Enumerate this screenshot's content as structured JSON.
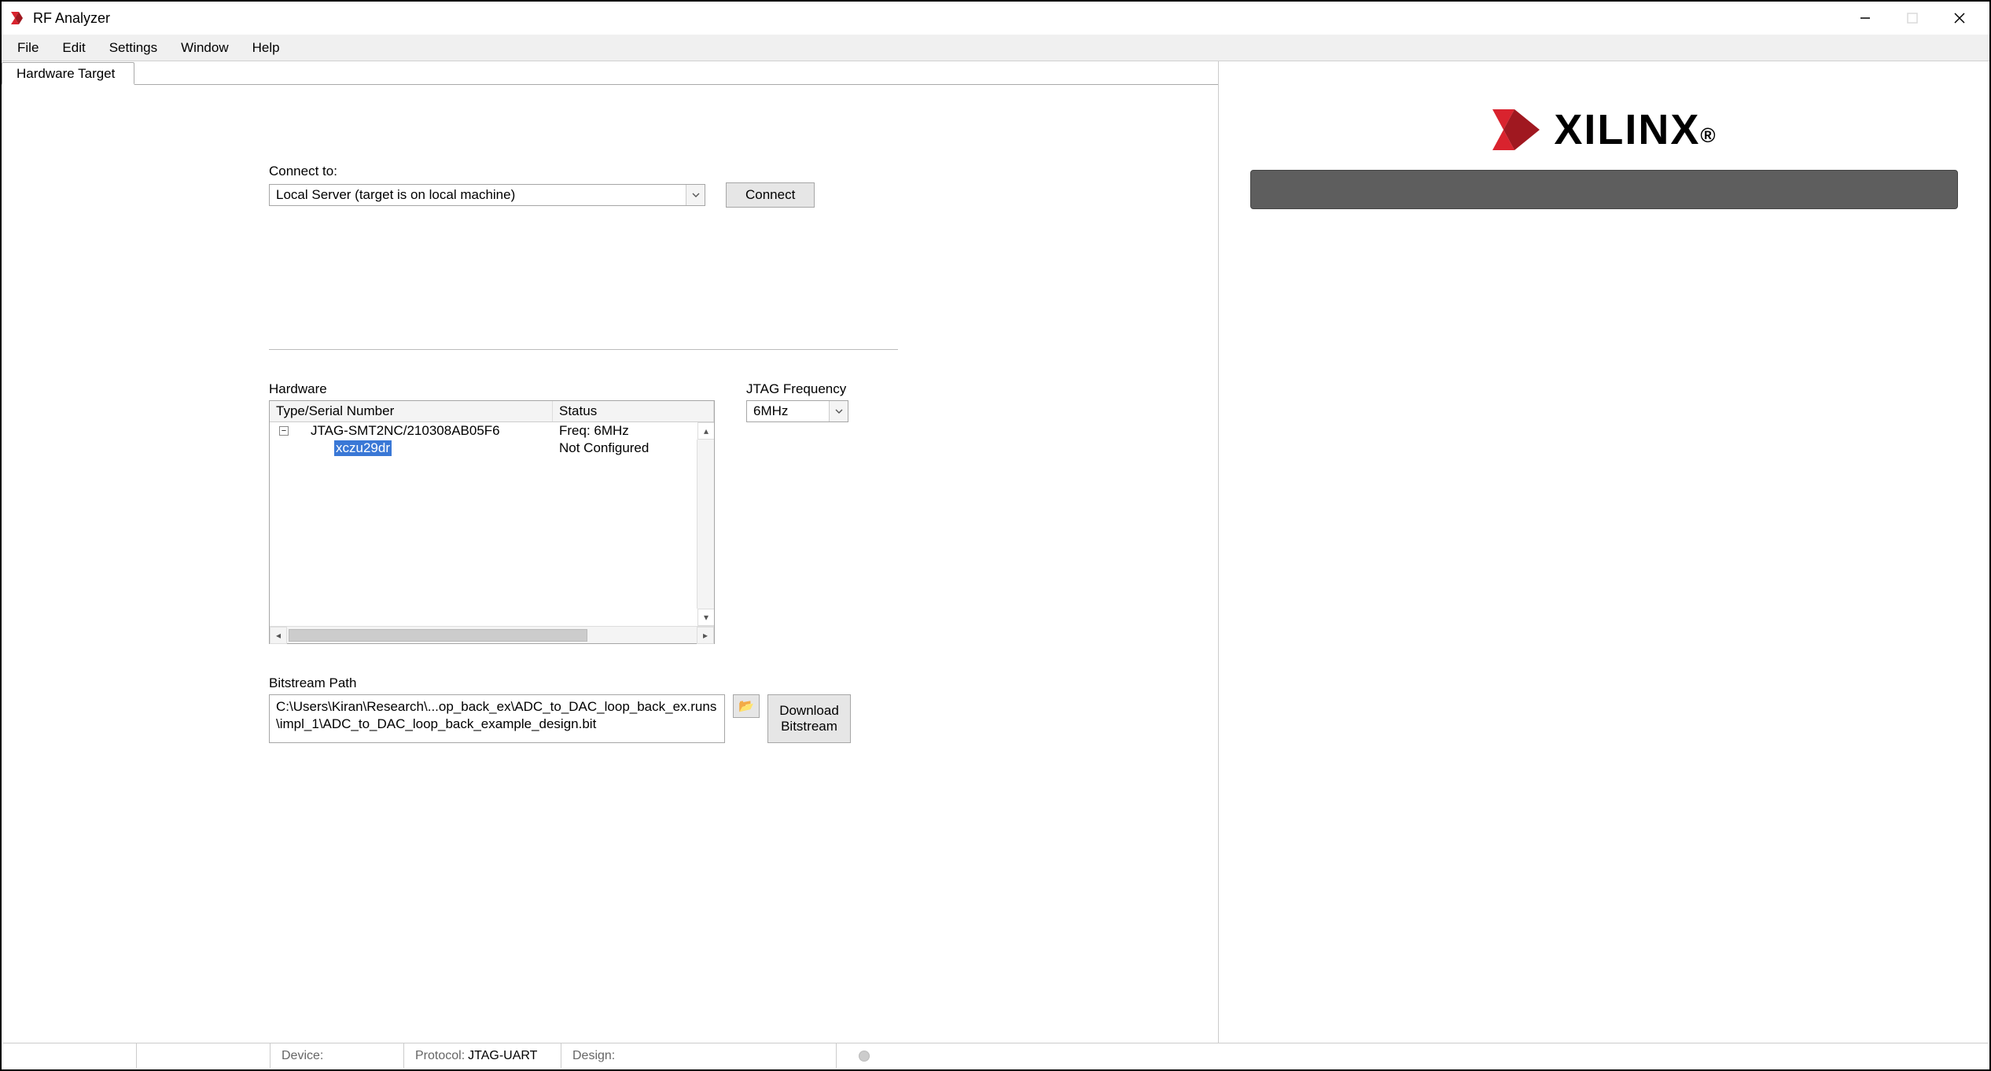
{
  "window": {
    "title": "RF Analyzer"
  },
  "menu": {
    "file": "File",
    "edit": "Edit",
    "settings": "Settings",
    "window": "Window",
    "help": "Help"
  },
  "tabs": {
    "hardware_target": "Hardware Target"
  },
  "connect": {
    "label": "Connect to:",
    "value": "Local Server (target is on local machine)",
    "button": "Connect"
  },
  "hardware": {
    "label": "Hardware",
    "col_type": "Type/Serial Number",
    "col_status": "Status",
    "row0_type": "JTAG-SMT2NC/210308AB05F6",
    "row0_status": "Freq: 6MHz",
    "row1_type": "xczu29dr",
    "row1_status": "Not Configured"
  },
  "jtag": {
    "label": "JTAG Frequency",
    "value": "6MHz"
  },
  "bitstream": {
    "label": "Bitstream Path",
    "path": "C:\\Users\\Kiran\\Research\\...op_back_ex\\ADC_to_DAC_loop_back_ex.runs\\impl_1\\ADC_to_DAC_loop_back_example_design.bit",
    "download_l1": "Download",
    "download_l2": "Bitstream"
  },
  "branding": {
    "name": "XILINX"
  },
  "status": {
    "device_lbl": "Device:",
    "device_val": "",
    "protocol_lbl": "Protocol:",
    "protocol_val": "JTAG-UART",
    "design_lbl": "Design:",
    "design_val": ""
  }
}
